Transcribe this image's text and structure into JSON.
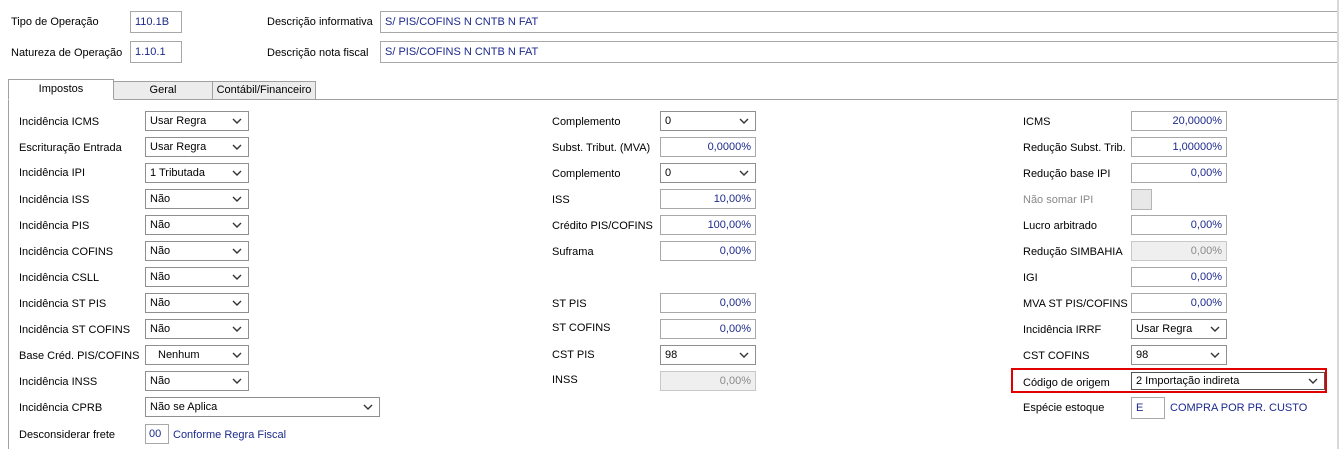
{
  "header": {
    "tipo_operacao_label": "Tipo de Operação",
    "tipo_operacao_value": "110.1B",
    "natureza_label": "Natureza de Operação",
    "natureza_value": "1.10.1",
    "descricao_informativa_label": "Descrição informativa",
    "descricao_informativa_value": "S/ PIS/COFINS N CNTB N FAT",
    "descricao_nf_label": "Descrição nota fiscal",
    "descricao_nf_value": "S/ PIS/COFINS N CNTB N FAT"
  },
  "tabs": [
    {
      "label": "Impostos",
      "active": true
    },
    {
      "label": "Geral",
      "active": false
    },
    {
      "label": "Contábil/Financeiro",
      "active": false
    }
  ],
  "left": {
    "incidencia_icms": {
      "label": "Incidência ICMS",
      "value": "Usar Regra"
    },
    "escrituracao_entrada": {
      "label": "Escrituração Entrada",
      "value": "Usar Regra"
    },
    "incidencia_ipi": {
      "label": "Incidência IPI",
      "value": "1 Tributada"
    },
    "incidencia_iss": {
      "label": "Incidência ISS",
      "value": "Não"
    },
    "incidencia_pis": {
      "label": "Incidência PIS",
      "value": "Não"
    },
    "incidencia_cofins": {
      "label": "Incidência COFINS",
      "value": "Não"
    },
    "incidencia_csll": {
      "label": "Incidência CSLL",
      "value": "Não"
    },
    "incidencia_st_pis": {
      "label": "Incidência ST PIS",
      "value": "Não"
    },
    "incidencia_st_cofins": {
      "label": "Incidência ST COFINS",
      "value": "Não"
    },
    "base_cred_pis_cofins": {
      "label": "Base Créd. PIS/COFINS",
      "value": "Nenhum"
    },
    "incidencia_inss": {
      "label": "Incidência INSS",
      "value": "Não"
    },
    "incidencia_cprb": {
      "label": "Incidência CPRB",
      "value": "Não se Aplica"
    },
    "desconsiderar_frete": {
      "label": "Desconsiderar frete",
      "value": "00",
      "link": "Conforme Regra Fiscal"
    }
  },
  "middle": {
    "complemento1": {
      "label": "Complemento",
      "value": "0"
    },
    "subst_tribut": {
      "label": "Subst. Tribut. (MVA)",
      "value": "0,0000%"
    },
    "complemento2": {
      "label": "Complemento",
      "value": "0"
    },
    "iss": {
      "label": "ISS",
      "value": "10,00%"
    },
    "credito_pis_cofins": {
      "label": "Crédito PIS/COFINS",
      "value": "100,00%"
    },
    "suframa": {
      "label": "Suframa",
      "value": "0,00%"
    },
    "st_pis": {
      "label": "ST PIS",
      "value": "0,00%"
    },
    "st_cofins": {
      "label": "ST COFINS",
      "value": "0,00%"
    },
    "cst_pis": {
      "label": "CST PIS",
      "value": "98"
    },
    "inss": {
      "label": "INSS",
      "value": "0,00%"
    }
  },
  "right": {
    "icms": {
      "label": "ICMS",
      "value": "20,0000%"
    },
    "reducao_subst_trib": {
      "label": "Redução Subst. Trib.",
      "value": "1,00000%"
    },
    "reducao_base_ipi": {
      "label": "Redução base IPI",
      "value": "0,00%"
    },
    "nao_somar_ipi": {
      "label": "Não somar IPI"
    },
    "lucro_arbitrado": {
      "label": "Lucro arbitrado",
      "value": "0,00%"
    },
    "reducao_simbahia": {
      "label": "Redução SIMBAHIA",
      "value": "0,00%"
    },
    "igi": {
      "label": "IGI",
      "value": "0,00%"
    },
    "mva_st_pis_cofins": {
      "label": "MVA ST PIS/COFINS",
      "value": "0,00%"
    },
    "incidencia_irrf": {
      "label": "Incidência IRRF",
      "value": "Usar Regra"
    },
    "cst_cofins": {
      "label": "CST COFINS",
      "value": "98"
    },
    "codigo_origem": {
      "label": "Código de origem",
      "value": "2 Importação indireta"
    },
    "especie_estoque": {
      "label": "Espécie estoque",
      "value": "E",
      "link": "COMPRA POR PR. CUSTO"
    }
  },
  "colors": {
    "value_text": "#1c2a8c",
    "highlight_border": "#e00000",
    "disabled_bg": "#efefef"
  }
}
